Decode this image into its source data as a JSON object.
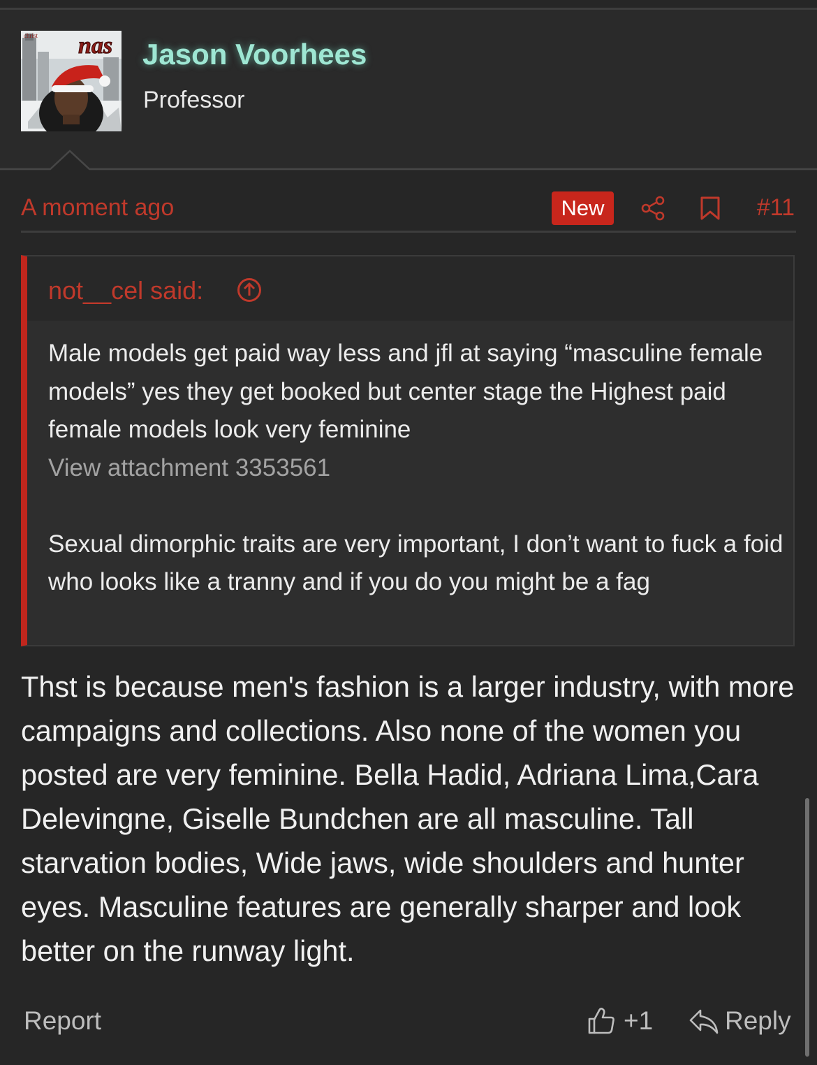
{
  "user": {
    "name": "Jason Voorhees",
    "title": "Professor",
    "avatar_text": "nas"
  },
  "meta": {
    "timestamp": "A moment ago",
    "badge": "New",
    "post_number": "#11"
  },
  "quote": {
    "author": "not__cel said:",
    "line1": "Male models get paid way less and jfl at saying “masculine female models” yes they get booked but center stage the Highest paid female models look very feminine",
    "attachment": "View attachment 3353561",
    "line2": "Sexual dimorphic traits are very important, I don’t want to fuck a foid who looks like a tranny and if you do you might be a fag"
  },
  "post": {
    "body": "Thst is because men's fashion is a larger industry, with more campaigns and collections. Also none of the women you posted are very feminine. Bella Hadid, Adriana Lima,Cara Delevingne, Giselle Bundchen are all masculine. Tall starvation bodies, Wide jaws, wide shoulders and hunter eyes. Masculine features are generally sharper and look better on the runway light."
  },
  "footer": {
    "report": "Report",
    "like_count": "+1",
    "reply": "Reply"
  },
  "colors": {
    "background": "#262626",
    "username": "#9ee6d3",
    "accent_red": "#c0392b",
    "badge_red": "#c8261c",
    "quote_bar": "#c0261d",
    "text": "#f0f0f0",
    "muted": "#bdbdbd"
  },
  "icons": {
    "share": "share-icon",
    "bookmark": "bookmark-icon",
    "quote_jump": "arrow-up-circle-icon",
    "like": "thumbs-up-icon",
    "reply": "reply-arrow-icon"
  }
}
